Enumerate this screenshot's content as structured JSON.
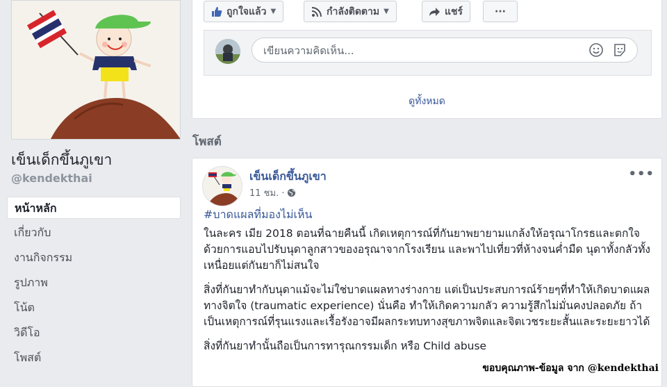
{
  "sidebar": {
    "page_name": "เข็นเด็กขึ้นภูเขา",
    "page_handle": "@kendekthai",
    "nav": [
      {
        "label": "หน้าหลัก",
        "active": true
      },
      {
        "label": "เกี่ยวกับ"
      },
      {
        "label": "งานกิจกรรม"
      },
      {
        "label": "รูปภาพ"
      },
      {
        "label": "โน้ต"
      },
      {
        "label": "วิดีโอ"
      },
      {
        "label": "โพสต์"
      }
    ]
  },
  "actions": {
    "like_label": "ถูกใจแล้ว",
    "follow_label": "กำลังติดตาม",
    "share_label": "แชร์",
    "more_label": "···"
  },
  "comment": {
    "placeholder": "เขียนความคิดเห็น..."
  },
  "see_all_label": "ดูทั้งหมด",
  "posts_header": "โพสต์",
  "post": {
    "author": "เข็นเด็กขึ้นภูเขา",
    "time": "11 ชม. ·",
    "hashtag": "#บาดแผลที่มองไม่เห็น",
    "paragraphs": [
      "ในละคร เมีย 2018 ตอนที่ฉายคืนนี้ เกิดเหตุการณ์ที่กันยาพยายามแกล้งให้อรุณาโกรธและตกใจ ด้วยการแอบไปรับนุดาลูกสาวของอรุณาจากโรงเรียน และพาไปเที่ยวที่ห้างจนค่ำมืด นุดาทั้งกลัวทั้งเหนื่อยแต่กันยาก็ไม่สนใจ",
      "สิ่งที่กันยาทำกับนุดาแม้จะไม่ใช่บาดแผลทางร่างกาย แต่เป็นประสบการณ์ร้ายๆที่ทำให้เกิดบาดแผลทางจิตใจ (traumatic experience) นั่นคือ ทำให้เกิดความกลัว ความรู้สึกไม่มั่นคงปลอดภัย ถ้าเป็นเหตุการณ์ที่รุนแรงและเรื้อรังอาจมีผลกระทบทางสุขภาพจิตและจิตเวชระยะสั้นและระยะยาวได้",
      "สิ่งที่กันยาทำนั้นถือเป็นการทารุณกรรมเด็ก หรือ Child abuse"
    ],
    "more_label": "•••"
  },
  "watermark": "ขอบคุณภาพ-ข้อมูล จาก @kendekthai",
  "colors": {
    "link": "#385898",
    "background": "#e9ebee",
    "hat": "#5fc352",
    "shirt": "#26336b",
    "shorts": "#f3e21a",
    "mountain": "#8a3d24"
  }
}
